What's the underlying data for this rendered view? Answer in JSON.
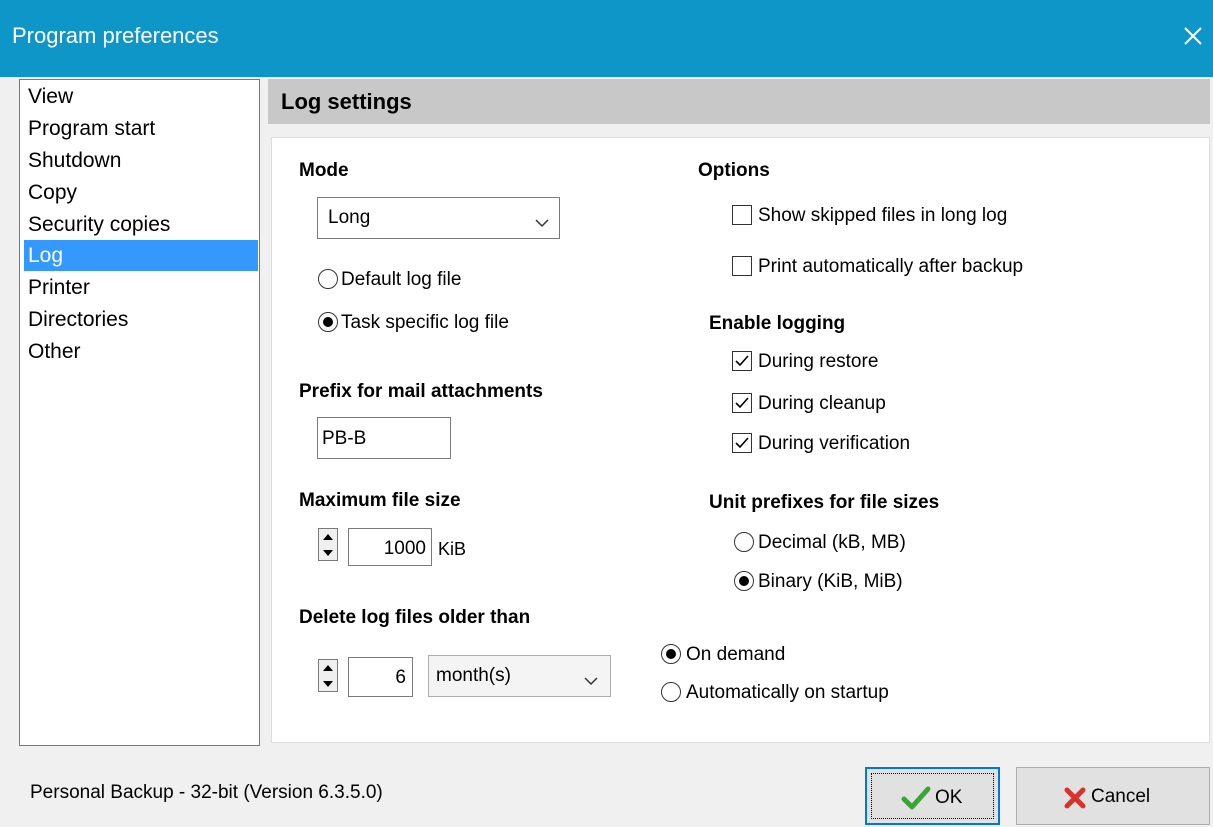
{
  "window": {
    "title": "Program preferences"
  },
  "nav": {
    "items": [
      "View",
      "Program start",
      "Shutdown",
      "Copy",
      "Security copies",
      "Log",
      "Printer",
      "Directories",
      "Other"
    ],
    "selected": "Log"
  },
  "header": {
    "title": "Log settings"
  },
  "mode": {
    "heading": "Mode",
    "value": "Long",
    "default_log": "Default log file",
    "task_log": "Task specific log file",
    "selected": "Task specific log file"
  },
  "prefix": {
    "heading": "Prefix for mail attachments",
    "value": "PB-B"
  },
  "maxsize": {
    "heading": "Maximum file size",
    "value": "1000",
    "unit": "KiB"
  },
  "delete": {
    "heading": "Delete log files older than",
    "value": "6",
    "unit": "month(s)",
    "on_demand": "On demand",
    "auto": "Automatically on startup",
    "selected": "On demand"
  },
  "options": {
    "heading": "Options",
    "show_skipped": {
      "label": "Show skipped files in long log",
      "checked": false
    },
    "print_auto": {
      "label": "Print automatically after backup",
      "checked": false
    }
  },
  "enable_logging": {
    "heading": "Enable logging",
    "restore": {
      "label": "During restore",
      "checked": true
    },
    "cleanup": {
      "label": "During cleanup",
      "checked": true
    },
    "verification": {
      "label": "During verification",
      "checked": true
    }
  },
  "unit_prefixes": {
    "heading": "Unit prefixes for file sizes",
    "decimal": "Decimal (kB, MB)",
    "binary": "Binary (KiB, MiB)",
    "selected": "Binary (KiB, MiB)"
  },
  "status": {
    "text": "Personal Backup - 32-bit (Version 6.3.5.0)"
  },
  "buttons": {
    "ok": "OK",
    "cancel": "Cancel"
  },
  "colors": {
    "titlebar": "#0f96c8",
    "selection": "#3399ff",
    "header": "#c8c8c8",
    "ok_green": "#3aa536",
    "cancel_red": "#d9322b"
  },
  "icons": {
    "close": "close-icon",
    "ok": "checkmark-icon",
    "cancel": "cross-icon",
    "dropdown": "chevron-down-icon"
  }
}
